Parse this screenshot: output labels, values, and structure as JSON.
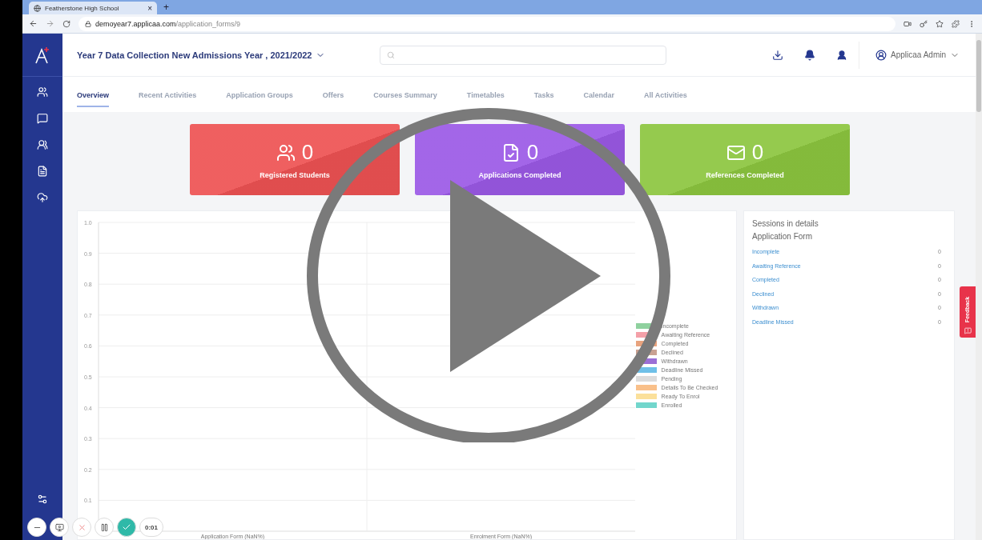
{
  "browser": {
    "tab": {
      "title": "Featherstone High School",
      "close": "×"
    },
    "new_tab": "+",
    "url": {
      "host": "demoyear7.applicaa.com",
      "path": "/application_forms/9"
    }
  },
  "header": {
    "title": "Year 7 Data Collection New Admissions Year , 2021/2022",
    "user": "Applicaa Admin"
  },
  "tabs": [
    {
      "label": "Overview",
      "selected": true
    },
    {
      "label": "Recent Activities",
      "selected": false
    },
    {
      "label": "Application Groups",
      "selected": false
    },
    {
      "label": "Offers",
      "selected": false
    },
    {
      "label": "Courses Summary",
      "selected": false
    },
    {
      "label": "Timetables",
      "selected": false
    },
    {
      "label": "Tasks",
      "selected": false
    },
    {
      "label": "Calendar",
      "selected": false
    },
    {
      "label": "All Activities",
      "selected": false
    }
  ],
  "stats": [
    {
      "value": "0",
      "label": "Registered Students",
      "color": "#ee5253"
    },
    {
      "value": "0",
      "label": "Applications Completed",
      "color": "#9b59e6"
    },
    {
      "value": "0",
      "label": "References Completed",
      "color": "#8cc63f"
    }
  ],
  "chart": {
    "chart_data": {
      "type": "bar",
      "categories": [
        "Application Form (NaN%)",
        "Enrolment Form (NaN%)"
      ],
      "ylim": [
        0,
        1
      ],
      "grid": true,
      "yticks": [
        0.1,
        0.2,
        0.3,
        0.4,
        0.5,
        0.6,
        0.7,
        0.8,
        0.9,
        {
          "value": 1,
          "label": "1.0"
        }
      ],
      "series": [
        {
          "name": "Incomplete",
          "color": "#8fd19e",
          "values": [
            null,
            null
          ]
        },
        {
          "name": "Awaiting Reference",
          "color": "#f4a0a8",
          "values": [
            null,
            null
          ]
        },
        {
          "name": "Completed",
          "color": "#e8a37e",
          "values": [
            null,
            null
          ]
        },
        {
          "name": "Declined",
          "color": "#c9a192",
          "values": [
            null,
            null
          ]
        },
        {
          "name": "Withdrawn",
          "color": "#9b6fd6",
          "values": [
            null,
            null
          ]
        },
        {
          "name": "Deadline Missed",
          "color": "#6fc0e8",
          "values": [
            null,
            null
          ]
        },
        {
          "name": "Pending",
          "color": "#dcdcdc",
          "values": [
            null,
            null
          ]
        },
        {
          "name": "Details To Be Checked",
          "color": "#f9c08a",
          "values": [
            null,
            null
          ]
        },
        {
          "name": "Ready To Enrol",
          "color": "#fbe09b",
          "values": [
            null,
            null
          ]
        },
        {
          "name": "Enrolled",
          "color": "#72d6cc",
          "values": [
            null,
            null
          ]
        }
      ]
    }
  },
  "sessions": {
    "title": "Sessions in details",
    "subtitle": "Application Form",
    "rows": [
      {
        "label": "Incomplete",
        "count": "0"
      },
      {
        "label": "Awaiting Reference",
        "count": "0"
      },
      {
        "label": "Completed",
        "count": "0"
      },
      {
        "label": "Declined",
        "count": "0"
      },
      {
        "label": "Withdrawn",
        "count": "0"
      },
      {
        "label": "Deadline Missed",
        "count": "0"
      }
    ]
  },
  "feedback": "Feedback",
  "recorder": {
    "timer": "0:01"
  }
}
